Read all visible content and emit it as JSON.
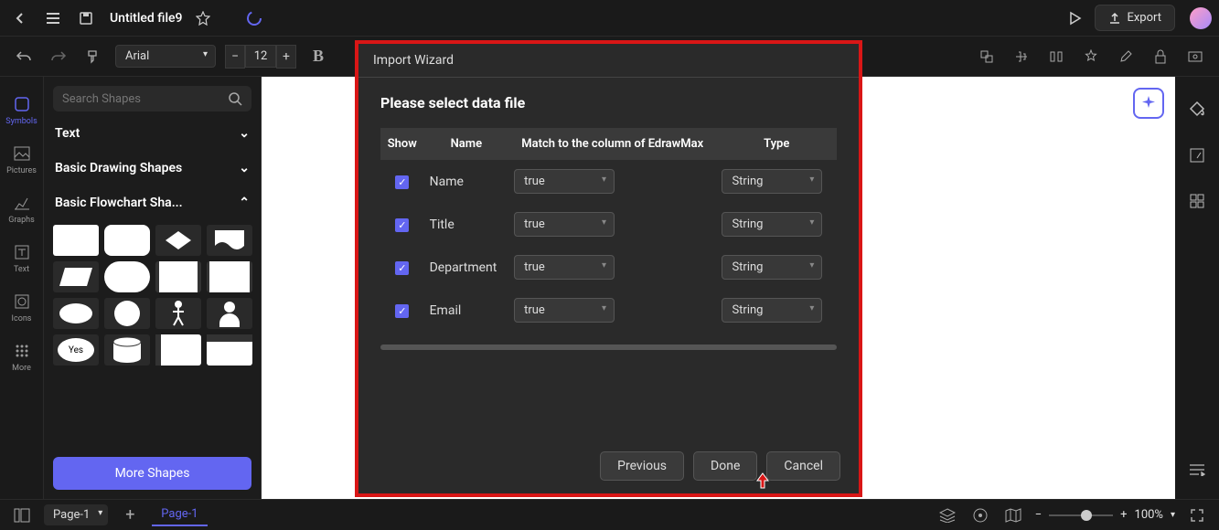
{
  "topbar": {
    "file_title": "Untitled file9",
    "export_label": "Export"
  },
  "toolbar": {
    "font_family": "Arial",
    "font_size": "12"
  },
  "leftrail": {
    "items": [
      {
        "label": "Symbols"
      },
      {
        "label": "Pictures"
      },
      {
        "label": "Graphs"
      },
      {
        "label": "Text"
      },
      {
        "label": "Icons"
      },
      {
        "label": "More"
      }
    ]
  },
  "sidebar": {
    "search_placeholder": "Search Shapes",
    "cat_text": "Text",
    "cat_basic_drawing": "Basic Drawing Shapes",
    "cat_basic_flowchart": "Basic Flowchart Sha...",
    "more_shapes": "More Shapes",
    "yes_label": "Yes"
  },
  "modal": {
    "title": "Import Wizard",
    "heading": "Please select data file",
    "headers": {
      "show": "Show",
      "name": "Name",
      "match": "Match to the column of EdrawMax",
      "type": "Type"
    },
    "rows": [
      {
        "name": "Name",
        "match": "true",
        "type": "String"
      },
      {
        "name": "Title",
        "match": "true",
        "type": "String"
      },
      {
        "name": "Department",
        "match": "true",
        "type": "String"
      },
      {
        "name": "Email",
        "match": "true",
        "type": "String"
      }
    ],
    "buttons": {
      "previous": "Previous",
      "done": "Done",
      "cancel": "Cancel"
    }
  },
  "bottom": {
    "page_select": "Page-1",
    "page_tab": "Page-1",
    "zoom_label": "100%"
  }
}
